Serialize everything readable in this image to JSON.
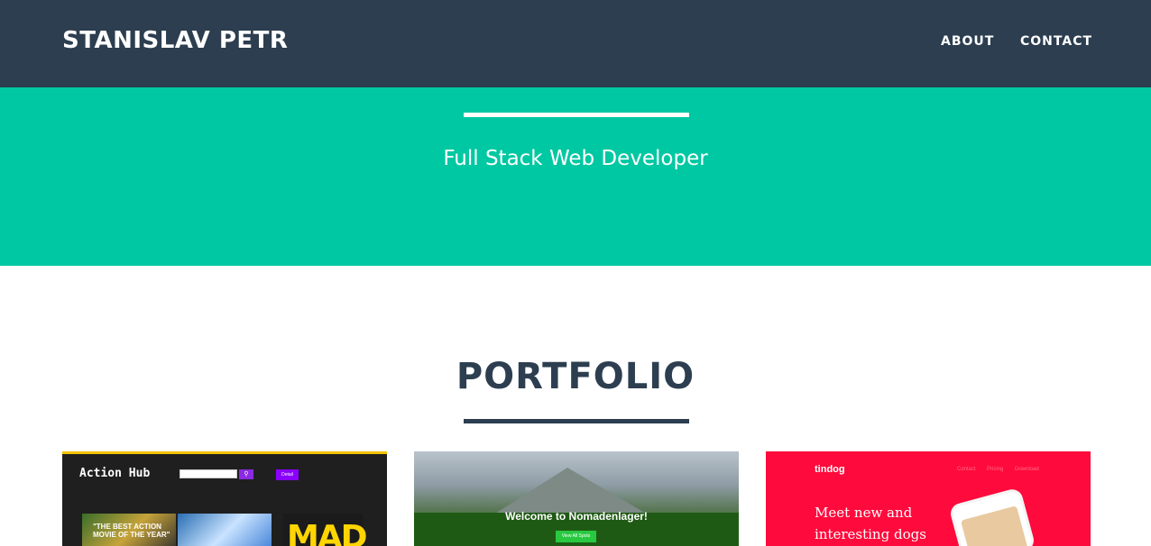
{
  "navbar": {
    "brand": "STANISLAV PETR",
    "links": [
      {
        "label": "ABOUT"
      },
      {
        "label": "CONTACT"
      }
    ]
  },
  "hero": {
    "subtitle": "Full Stack Web Developer"
  },
  "portfolio": {
    "title": "PORTFOLIO",
    "cards": [
      {
        "app_title": "Action Hub",
        "search_icon": "search-icon",
        "button_label": "Detail",
        "poster_text": "\"THE BEST ACTION MOVIE OF THE YEAR\"",
        "poster_title": "MAD"
      },
      {
        "headline": "Welcome to Nomadenlager!",
        "button_label": "View All Spots"
      },
      {
        "logo": "tindog",
        "nav": [
          "Contact",
          "Pricing",
          "Download"
        ],
        "heading_line1": "Meet new and",
        "heading_line2": "interesting dogs"
      }
    ]
  },
  "colors": {
    "navbar": "#2c3e50",
    "hero": "#00c8a2",
    "text_dark": "#2c3e50",
    "tindog_red": "#ff0a3c"
  }
}
